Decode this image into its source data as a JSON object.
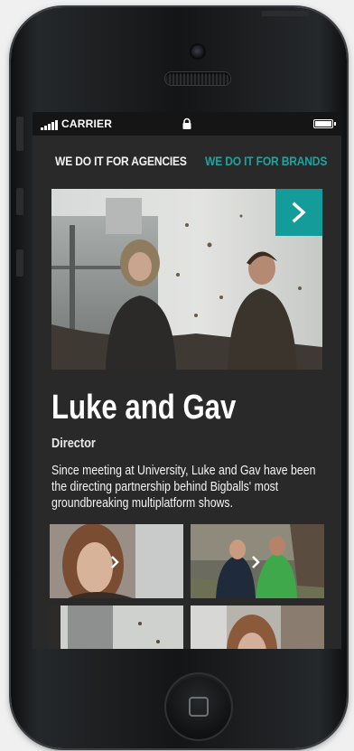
{
  "status_bar": {
    "carrier": "CARRIER"
  },
  "nav": {
    "agencies": "WE DO IT FOR AGENCIES",
    "brands": "WE DO IT FOR BRANDS"
  },
  "featured": {
    "name": "Luke and Gav",
    "role": "Director",
    "bio": "Since meeting at University, Luke and Gav have been the directing partnership behind Bigballs' most groundbreaking multiplatform shows."
  },
  "icons": {
    "hero_next": "chevron-right-icon",
    "lock": "lock-icon",
    "battery": "battery-icon",
    "signal": "signal-icon"
  },
  "colors": {
    "accent": "#139c99",
    "brands_link": "#1fa3a0",
    "screen_bg": "#292929"
  }
}
